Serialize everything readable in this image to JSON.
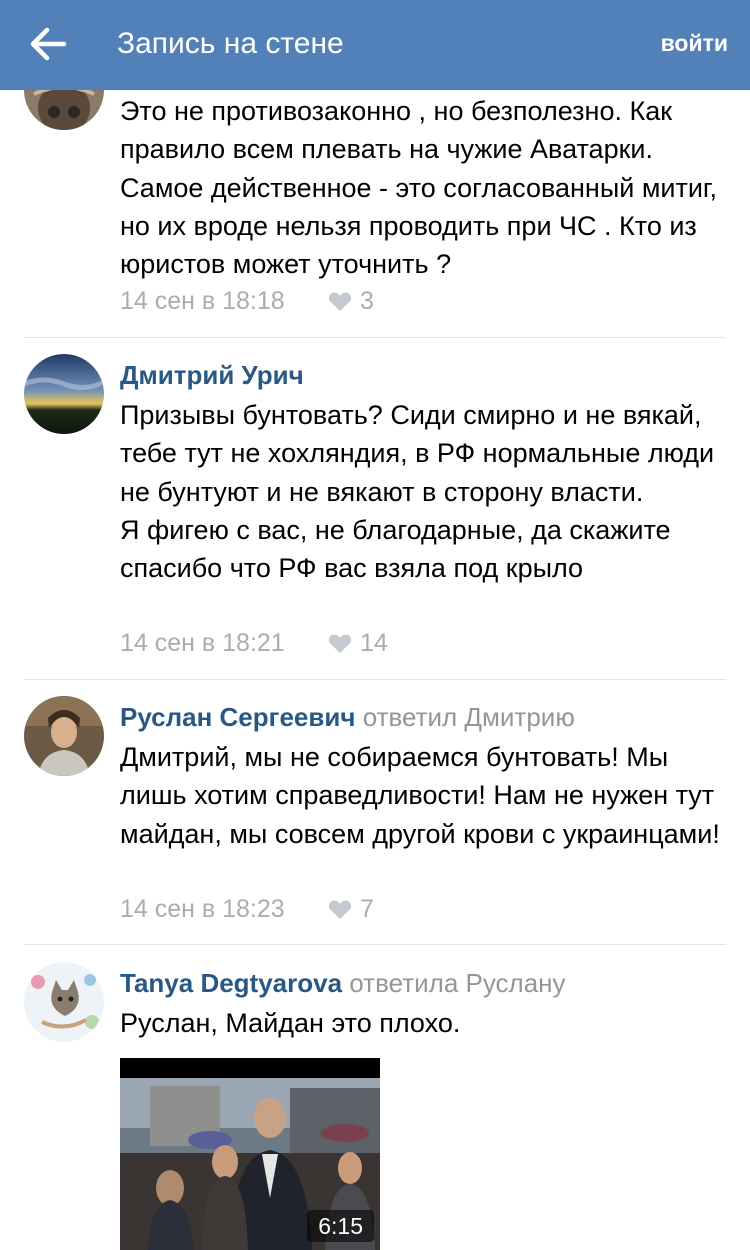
{
  "header": {
    "title": "Запись на стене",
    "login_label": "войти",
    "background": "#5181b8",
    "back_icon": "arrow-left-icon"
  },
  "comments": [
    {
      "text_lines": [
        "Это не противозаконно , но безполезно. Как правило всем плевать на чужие Аватарки. Самое действенное - это согласованный митиг, но их вроде нельзя проводить при ЧС . Кто из юристов может уточнить ?"
      ],
      "date": "14 сен в 18:18",
      "likes": "3"
    },
    {
      "author": "Дмитрий Урич",
      "text_lines": [
        "Призывы бунтовать? Сиди смирно и не вякай, тебе тут не хохляндия, в РФ нормальные люди не бунтуют и не вякают в сторону власти.",
        "Я фигею с вас, не благодарные, да скажите спасибо что РФ вас взяла под крыло"
      ],
      "date": "14 сен в 18:21",
      "likes": "14"
    },
    {
      "author": "Руслан Сергеевич",
      "reply_to": "ответил Дмитрию",
      "text_lines": [
        "Дмитрий, мы не собираемся бунтовать! Мы лишь хотим справедливости! Нам не нужен тут майдан, мы совсем другой крови с украинцами!"
      ],
      "date": "14 сен в 18:23",
      "likes": "7"
    },
    {
      "author": "Tanya Degtyarova",
      "reply_to": "ответила Руслану",
      "text_lines": [
        "Руслан, Майдан это плохо."
      ],
      "video_duration": "6:15"
    }
  ],
  "colors": {
    "author": "#2a5885",
    "meta": "#a8adb3",
    "reply": "#939699",
    "divider": "#e3e5e8"
  }
}
